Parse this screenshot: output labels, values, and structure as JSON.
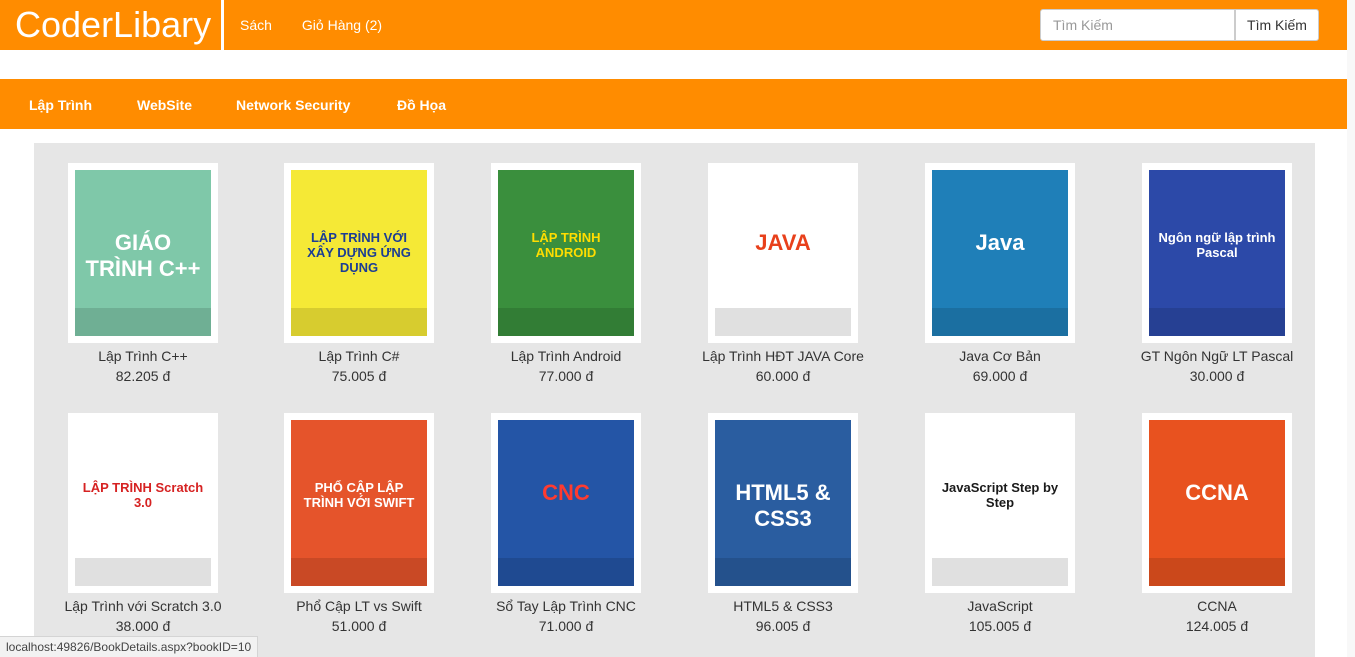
{
  "header": {
    "brand": "CoderLibary",
    "nav": [
      "Sách",
      "Giỏ Hàng (2)"
    ],
    "search_placeholder": "Tìm Kiếm",
    "search_button": "Tìm Kiếm"
  },
  "categories": [
    "Lập Trình",
    "WebSite",
    "Network Security",
    "Đồ Họa"
  ],
  "books": [
    {
      "name": "Lập Trình C++",
      "price": "82.205 đ",
      "cover": {
        "bg": "#7fc8a9",
        "fg": "#ffffff",
        "text": "GIÁO TRÌNH C++"
      }
    },
    {
      "name": "Lập Trình C#",
      "price": "75.005 đ",
      "cover": {
        "bg": "#f5e936",
        "fg": "#1b3d94",
        "text": "LẬP TRÌNH VỚI XÂY DỰNG ỨNG DỤNG"
      }
    },
    {
      "name": "Lập Trình Android",
      "price": "77.000 đ",
      "cover": {
        "bg": "#3a8f3d",
        "fg": "#ffdd00",
        "text": "LẬP TRÌNH ANDROID"
      }
    },
    {
      "name": "Lập Trình HĐT JAVA Core",
      "price": "60.000 đ",
      "cover": {
        "bg": "#ffffff",
        "fg": "#e8401b",
        "text": "JAVA"
      }
    },
    {
      "name": "Java Cơ Bản",
      "price": "69.000 đ",
      "cover": {
        "bg": "#1f7fb8",
        "fg": "#ffffff",
        "text": "Java"
      }
    },
    {
      "name": "GT Ngôn Ngữ LT Pascal",
      "price": "30.000 đ",
      "cover": {
        "bg": "#2c49a8",
        "fg": "#ffffff",
        "text": "Ngôn ngữ lập trình Pascal"
      }
    },
    {
      "name": "Lập Trình với Scratch 3.0",
      "price": "38.000 đ",
      "cover": {
        "bg": "#ffffff",
        "fg": "#d62222",
        "text": "LẬP TRÌNH Scratch 3.0"
      }
    },
    {
      "name": "Phổ Cập LT vs Swift",
      "price": "51.000 đ",
      "cover": {
        "bg": "#e5542b",
        "fg": "#ffffff",
        "text": "PHỔ CẬP LẬP TRÌNH VỚI SWIFT"
      }
    },
    {
      "name": "Sổ Tay Lập Trình CNC",
      "price": "71.000 đ",
      "cover": {
        "bg": "#2455a6",
        "fg": "#ff3b30",
        "text": "CNC"
      }
    },
    {
      "name": "HTML5 & CSS3",
      "price": "96.005 đ",
      "cover": {
        "bg": "#2a5da0",
        "fg": "#ffffff",
        "text": "HTML5 & CSS3"
      }
    },
    {
      "name": "JavaScript",
      "price": "105.005 đ",
      "cover": {
        "bg": "#ffffff",
        "fg": "#1a1a1a",
        "text": "JavaScript Step by Step"
      }
    },
    {
      "name": "CCNA",
      "price": "124.005 đ",
      "cover": {
        "bg": "#e8521f",
        "fg": "#ffffff",
        "text": "CCNA"
      }
    }
  ],
  "status_url": "localhost:49826/BookDetails.aspx?bookID=10",
  "colors": {
    "brand_orange": "#ff8c00",
    "panel_gray": "#e6e6e6"
  }
}
